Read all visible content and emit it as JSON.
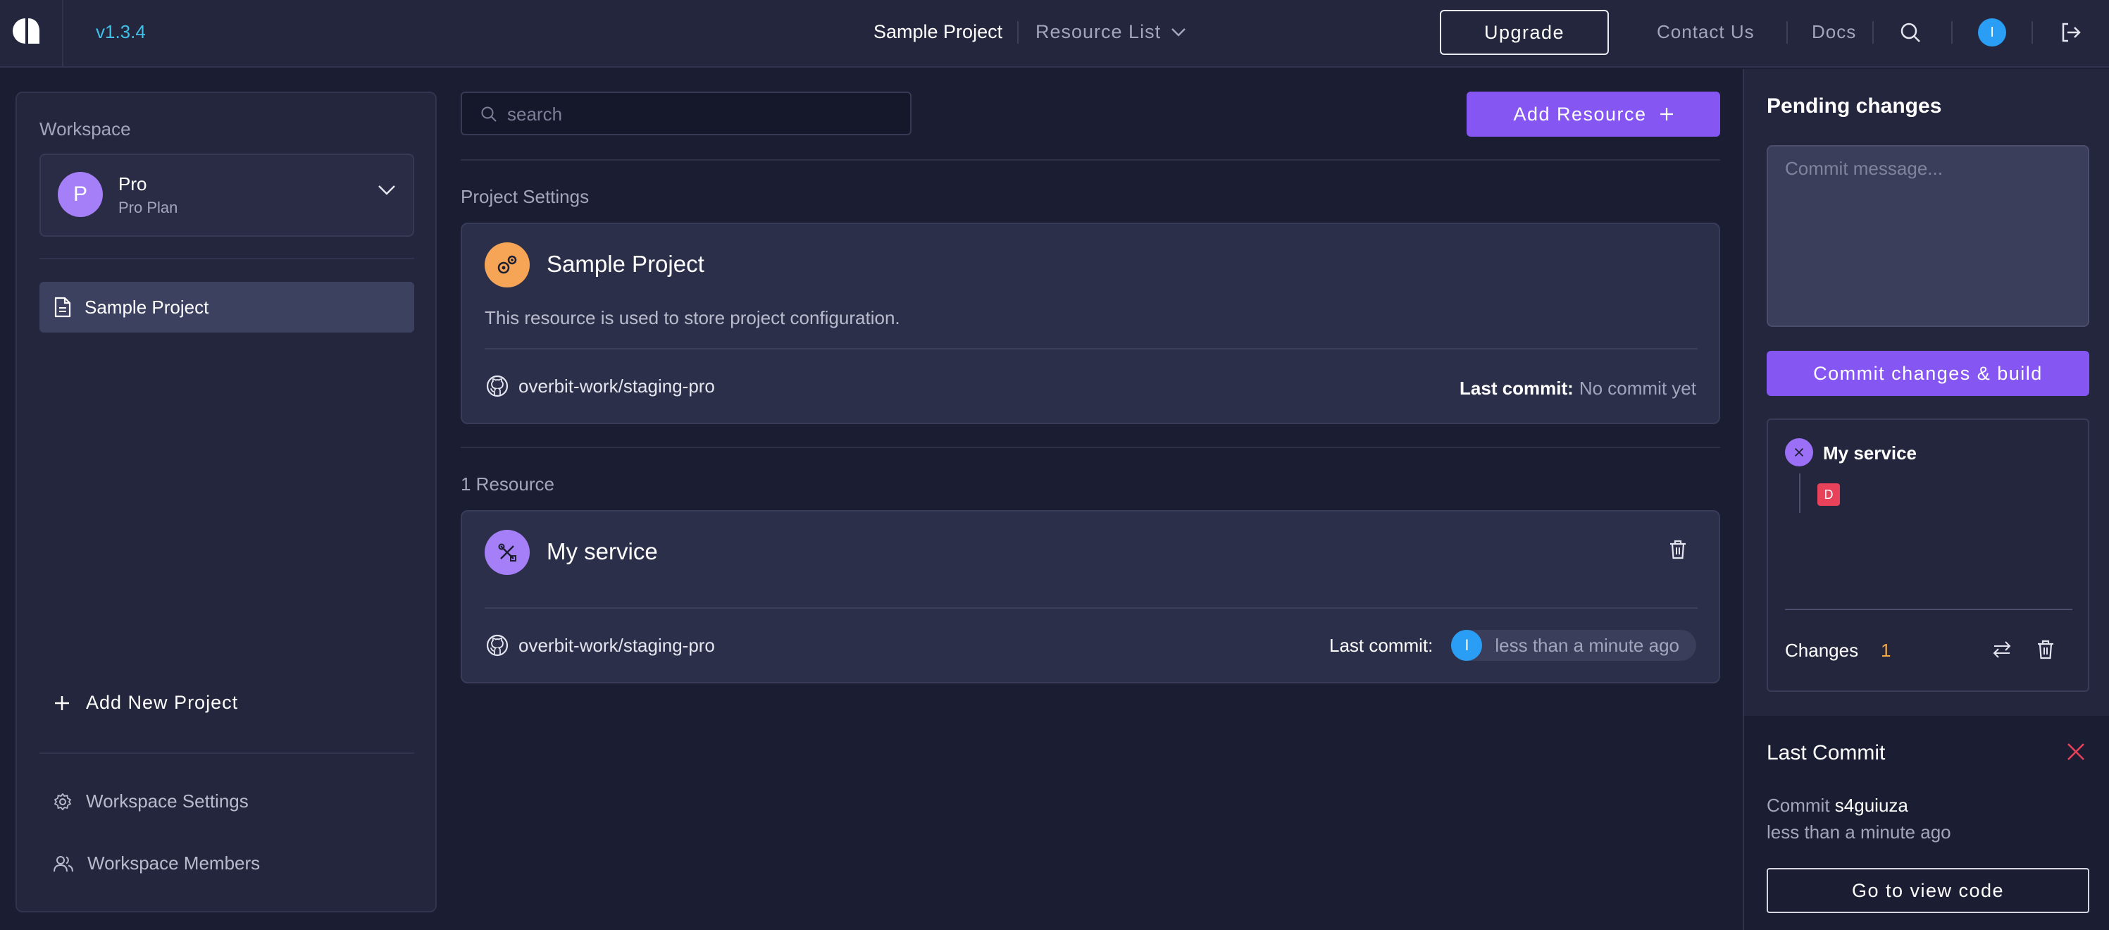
{
  "header": {
    "version": "v1.3.4",
    "project_name": "Sample Project",
    "resource_list_label": "Resource List",
    "upgrade_label": "Upgrade",
    "contact_label": "Contact Us",
    "docs_label": "Docs",
    "user_initial": "I"
  },
  "sidebar": {
    "workspace_label": "Workspace",
    "workspace": {
      "initial": "P",
      "name": "Pro",
      "plan": "Pro Plan"
    },
    "projects": [
      {
        "label": "Sample Project",
        "active": true
      }
    ],
    "add_project_label": "Add New Project",
    "settings_label": "Workspace Settings",
    "members_label": "Workspace Members"
  },
  "main": {
    "search_placeholder": "search",
    "add_resource_label": "Add Resource",
    "project_settings_label": "Project Settings",
    "project_card": {
      "title": "Sample Project",
      "description": "This resource is used to store project configuration.",
      "repo": "overbit-work/staging-pro",
      "last_commit_label": "Last commit:",
      "last_commit_value": "No commit yet"
    },
    "resources_label": "1 Resource",
    "resource_card": {
      "title": "My service",
      "repo": "overbit-work/staging-pro",
      "last_commit_label": "Last commit:",
      "commit_author_initial": "I",
      "last_commit_value": "less than a minute ago"
    }
  },
  "pending": {
    "title": "Pending changes",
    "commit_placeholder": "Commit message...",
    "commit_button_label": "Commit changes & build",
    "service_name": "My service",
    "change_badge": "D",
    "changes_label": "Changes",
    "changes_count": "1"
  },
  "last_commit": {
    "title": "Last Commit",
    "commit_prefix": "Commit",
    "commit_hash": "s4guiuza",
    "time": "less than a minute ago",
    "view_code_label": "Go to view code"
  },
  "colors": {
    "background": "#1b1e33",
    "panel": "#23263d",
    "accent_purple": "#8656f2",
    "accent_cyan": "#3fc1e8",
    "danger": "#e8425a",
    "warning": "#f0a848"
  }
}
